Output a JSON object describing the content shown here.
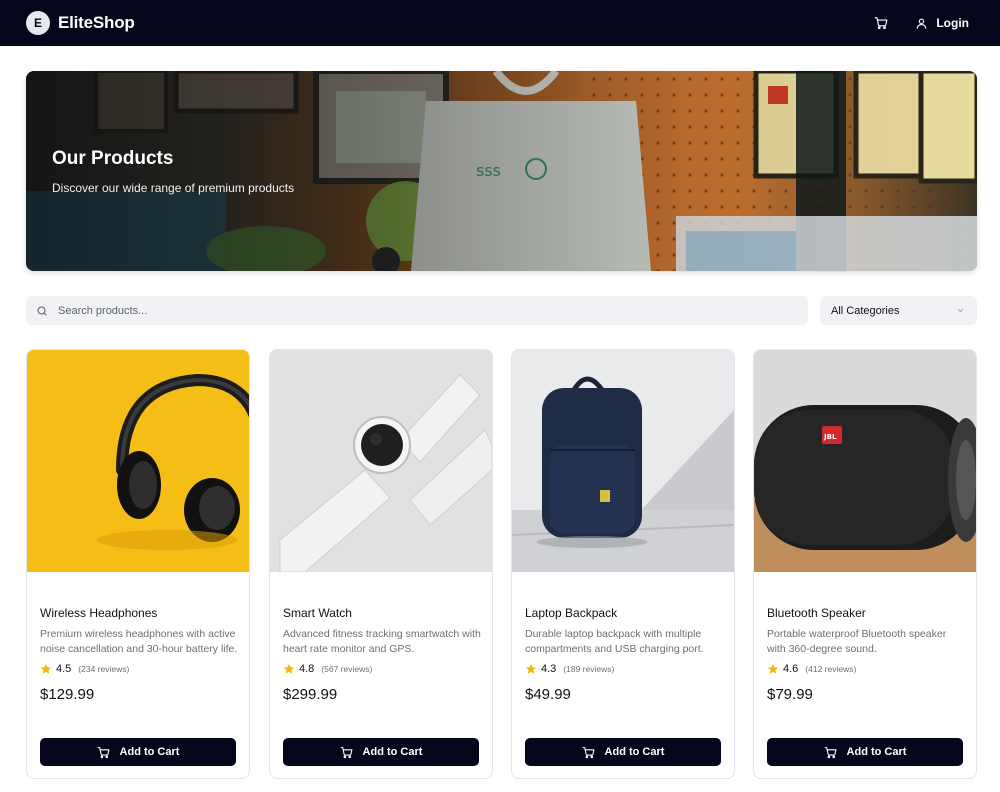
{
  "header": {
    "logo_letter": "E",
    "brand": "EliteShop",
    "cart_icon": "cart-icon",
    "login_icon": "user-icon",
    "login_label": "Login"
  },
  "hero": {
    "title": "Our Products",
    "subtitle": "Discover our wide range of premium products"
  },
  "search": {
    "placeholder": "Search products..."
  },
  "filter": {
    "selected": "All Categories"
  },
  "products": [
    {
      "name": "Wireless Headphones",
      "description": "Premium wireless headphones with active noise cancellation and 30-hour battery life.",
      "rating": "4.5",
      "reviews": "(234 reviews)",
      "price": "$129.99",
      "cta": "Add to Cart"
    },
    {
      "name": "Smart Watch",
      "description": "Advanced fitness tracking smartwatch with heart rate monitor and GPS.",
      "rating": "4.8",
      "reviews": "(567 reviews)",
      "price": "$299.99",
      "cta": "Add to Cart"
    },
    {
      "name": "Laptop Backpack",
      "description": "Durable laptop backpack with multiple compartments and USB charging port.",
      "rating": "4.3",
      "reviews": "(189 reviews)",
      "price": "$49.99",
      "cta": "Add to Cart"
    },
    {
      "name": "Bluetooth Speaker",
      "description": "Portable waterproof Bluetooth speaker with 360-degree sound.",
      "rating": "4.6",
      "reviews": "(412 reviews)",
      "price": "$79.99",
      "cta": "Add to Cart"
    }
  ],
  "colors": {
    "header_bg": "#05051c",
    "button_bg": "#05051c",
    "star": "#f5b800"
  }
}
